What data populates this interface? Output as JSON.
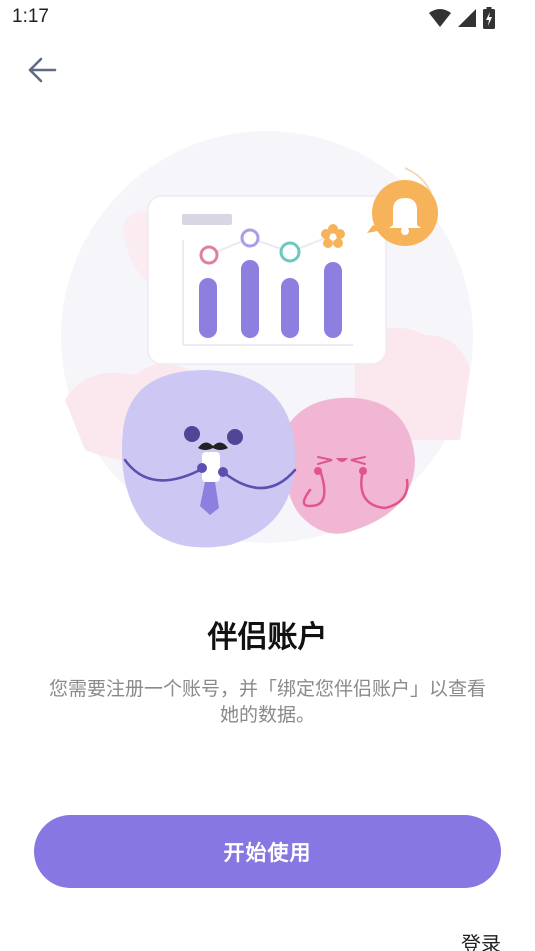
{
  "status_bar": {
    "time": "1:17",
    "icons": [
      "wifi-icon",
      "cellular-signal-icon",
      "battery-charging-icon"
    ]
  },
  "header": {
    "back_icon": "arrow-left-icon"
  },
  "illustration": {
    "description_icons": [
      "bar-chart-card",
      "bell-icon",
      "purple-character",
      "pink-character"
    ],
    "colors": {
      "circle_bg": "#f6f5f9",
      "bar": "#8d7fe0",
      "bell": "#f7b35a",
      "purple_character": "#cdc8f3",
      "pink_character": "#f1b6d4"
    }
  },
  "main": {
    "title": "伴侣账户",
    "description": "您需要注册一个账号，并「绑定您伴侣账户」以查看她的数据。"
  },
  "actions": {
    "primary_label": "开始使用",
    "login_label": "登录"
  },
  "colors": {
    "accent": "#8677e3",
    "title_text": "#111111",
    "description_text": "#8a8a8a"
  }
}
